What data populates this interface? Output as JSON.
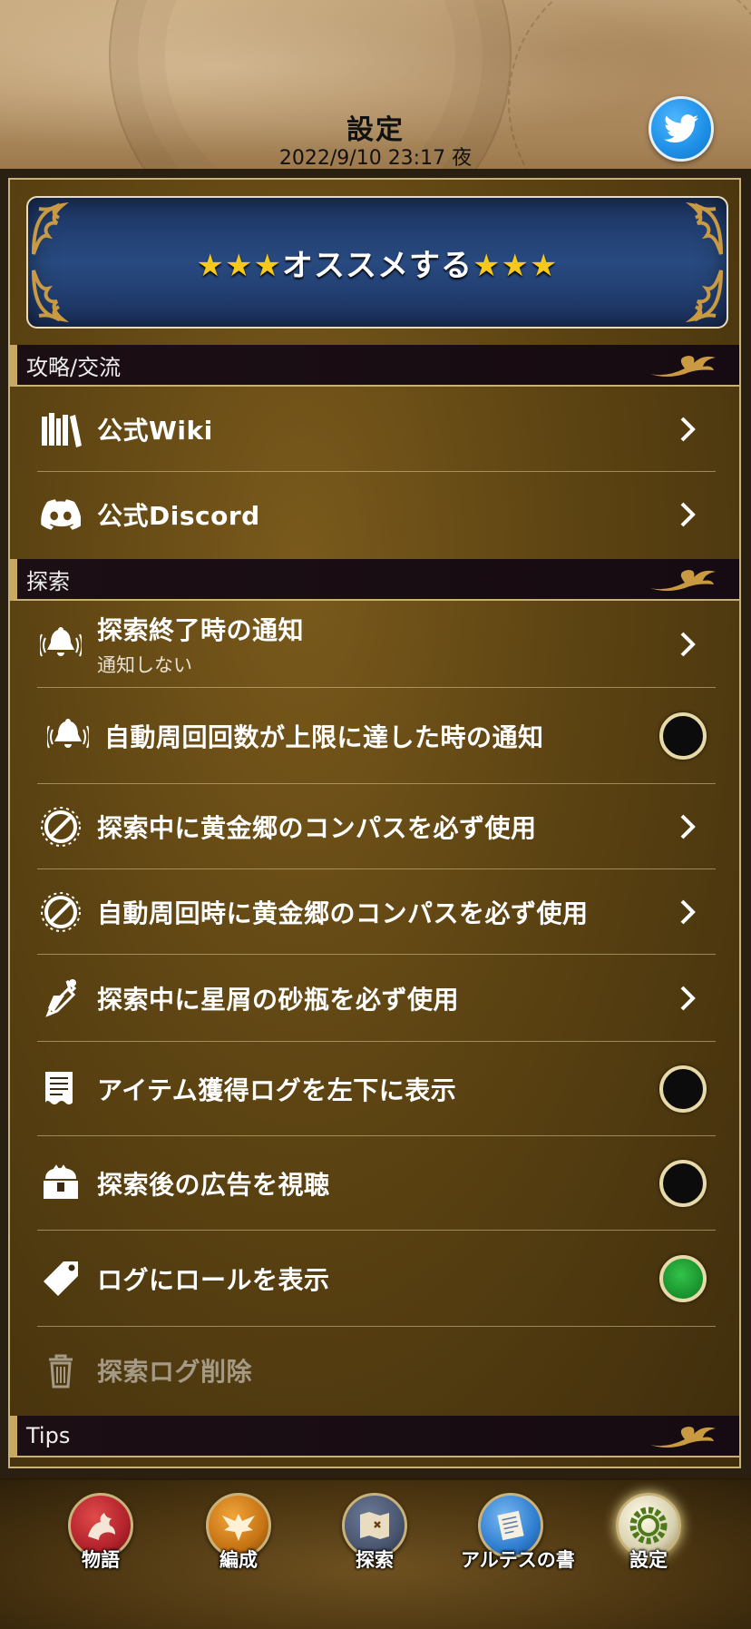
{
  "header": {
    "title": "設定",
    "datetime": "2022/9/10  23:17  夜"
  },
  "banner": {
    "stars_left": "★★★",
    "text": "オススメする",
    "stars_right": "★★★"
  },
  "sections": [
    {
      "title": "攻略/交流"
    },
    {
      "title": "探索"
    },
    {
      "title": "Tips"
    }
  ],
  "rows": [
    {
      "label": "公式Wiki",
      "icon": "books-icon"
    },
    {
      "label": "公式Discord",
      "icon": "discord-icon"
    },
    {
      "label": "探索終了時の通知",
      "sub": "通知しない",
      "icon": "bell-icon"
    },
    {
      "label": "自動周回回数が上限に達した時の通知",
      "icon": "bell-icon",
      "toggle": false
    },
    {
      "label": "探索中に黄金郷のコンパスを必ず使用",
      "icon": "compass-icon"
    },
    {
      "label": "自動周回時に黄金郷のコンパスを必ず使用",
      "icon": "compass-icon"
    },
    {
      "label": "探索中に星屑の砂瓶を必ず使用",
      "icon": "sand-bottle-icon"
    },
    {
      "label": "アイテム獲得ログを左下に表示",
      "icon": "log-scroll-icon",
      "toggle": false
    },
    {
      "label": "探索後の広告を視聴",
      "icon": "treasure-chest-icon",
      "toggle": false
    },
    {
      "label": "ログにロールを表示",
      "icon": "tag-icon",
      "toggle": true
    },
    {
      "label": "探索ログ削除",
      "icon": "trash-icon"
    }
  ],
  "nav": [
    {
      "label": "物語",
      "icon": "dragon-icon",
      "color": "#b3232c"
    },
    {
      "label": "編成",
      "icon": "eagle-emblem-icon",
      "color": "#c77414"
    },
    {
      "label": "探索",
      "icon": "map-icon",
      "color": "#4a5670"
    },
    {
      "label": "アルテスの書",
      "icon": "scroll-icon",
      "color": "#2f7ed1"
    },
    {
      "label": "設定",
      "icon": "gear-icon",
      "color": "#d9d2b0"
    }
  ],
  "colors": {
    "accent_gold": "#c9b27a",
    "toggle_on": "#1fa83a",
    "banner_blue": "#284a80"
  }
}
